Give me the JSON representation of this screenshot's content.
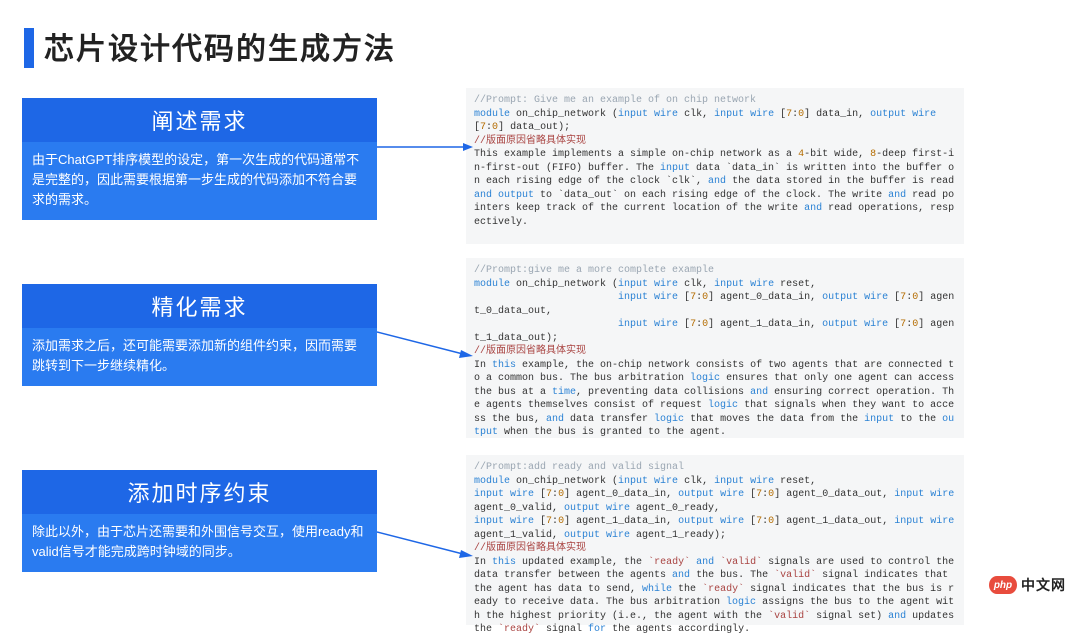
{
  "title": "芯片设计代码的生成方法",
  "steps": [
    {
      "header": "阐述需求",
      "body": "由于ChatGPT排序模型的设定，第一次生成的代码通常不是完整的，因此需要根据第一步生成的代码添加不符合要求的需求。"
    },
    {
      "header": "精化需求",
      "body": "添加需求之后，还可能需要添加新的组件约束，因而需要跳转到下一步继续精化。"
    },
    {
      "header": "添加时序约束",
      "body": "除此以外，由于芯片还需要和外围信号交互，使用ready和valid信号才能完成跨时钟域的同步。"
    }
  ],
  "code_blocks": [
    {
      "prompt": "//Prompt: Give me an example of on chip network",
      "module": "module on_chip_network (input wire clk, input wire [7:0] data_in, output wire [7:0] data_out);",
      "note": "//版面原因省略具体实现",
      "desc_pre": "This example implements a simple on-chip network as a ",
      "desc_num1": "4",
      "desc_mid1": "-bit wide, ",
      "desc_num2": "8",
      "desc_mid2": "-deep first-in-first-out (FIFO) buffer. The ",
      "desc_seg1": "input",
      "desc_mid3": " data `data_in` is written into the buffer on each rising edge of the clock `clk`, ",
      "desc_seg2": "and",
      "desc_mid4": " the data stored in the buffer is read ",
      "desc_seg3": "and output",
      "desc_mid5": " to `data_out` on each rising edge of the clock. The write ",
      "desc_seg4": "and",
      "desc_mid6": " read pointers keep track of the current location of the write ",
      "desc_seg5": "and",
      "desc_tail": " read operations, respectively."
    },
    {
      "prompt": "//Prompt:give me a more complete example",
      "module_l1": "module on_chip_network (input wire clk, input wire reset,",
      "module_l2": "                        input wire [7:0] agent_0_data_in, output wire [7:0] agent_0_data_out,",
      "module_l3": "                        input wire [7:0] agent_1_data_in, output wire [7:0] agent_1_data_out);",
      "note": "//版面原因省略具体实现",
      "desc": "In this example, the on-chip network consists of two agents that are connected to a common bus. The bus arbitration logic ensures that only one agent can access the bus at a time, preventing data collisions and ensuring correct operation. The agents themselves consist of request logic that signals when they want to access the bus, and data transfer logic that moves the data from the input to the output when the bus is granted to the agent."
    },
    {
      "prompt": "//Prompt:add ready and valid signal",
      "module_l1": "module on_chip_network (input wire clk, input wire reset,",
      "module_l2": "input wire [7:0] agent_0_data_in, output wire [7:0] agent_0_data_out, input wire agent_0_valid, output wire agent_0_ready,",
      "module_l3": "input wire [7:0] agent_1_data_in, output wire [7:0] agent_1_data_out, input wire agent_1_valid, output wire agent_1_ready);",
      "note": "//版面原因省略具体实现",
      "desc": "In this updated example, the `ready` and `valid` signals are used to control the data transfer between the agents and the bus. The `valid` signal indicates that the agent has data to send, while the `ready` signal indicates that the bus is ready to receive data. The bus arbitration logic assigns the bus to the agent with the highest priority (i.e., the agent with the `valid` signal set) and updates the `ready` signal for the agents accordingly."
    }
  ],
  "logo": {
    "icon_text": "php",
    "label": "中文网"
  },
  "colors": {
    "primary": "#1e67e6",
    "secondary": "#2a7bf0",
    "code_bg": "#f5f6f7"
  }
}
